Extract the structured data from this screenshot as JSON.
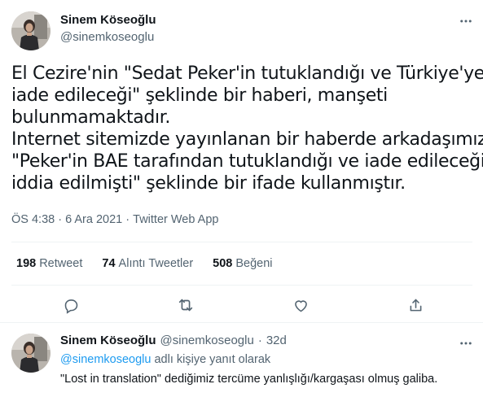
{
  "tweet": {
    "author_name": "Sinem Köseoğlu",
    "author_handle": "@sinemkoseoglu",
    "text_lines": [
      "El Cezire'nin \"Sedat Peker'in tutuklandığı ve Türkiye'ye",
      "iade edileceği\" şeklinde bir haberi, manşeti",
      "bulunmamaktadır.",
      "Internet sitemizde yayınlanan bir haberde arkadaşımız",
      "\"Peker'in BAE tarafından tutuklandığı ve iade edileceği",
      "iddia edilmişti\" şeklinde bir ifade kullanmıştır."
    ],
    "time": "ÖS 4:38",
    "separator": " · ",
    "date": "6 Ara 2021",
    "source": "Twitter Web App"
  },
  "stats": {
    "retweets_count": "198",
    "retweets_label": "Retweet",
    "quotes_count": "74",
    "quotes_label": "Alıntı Tweetler",
    "likes_count": "508",
    "likes_label": "Beğeni"
  },
  "reply": {
    "author_name": "Sinem Köseoğlu",
    "author_handle": "@sinemkoseoglu",
    "separator": "·",
    "age": "32d",
    "replying_to_handle": "@sinemkoseoglu",
    "replying_to_suffix": " adlı kişiye yanıt olarak",
    "text": "\"Lost in translation\" dediğimiz tercüme yanlışlığı/kargaşası olmuş galiba."
  },
  "colors": {
    "text": "#0f1419",
    "secondary": "#536471",
    "link": "#1d9bf0",
    "border": "#eff3f4"
  },
  "icons": {
    "more": "more-horizontal-icon",
    "reply": "reply-icon",
    "retweet": "retweet-icon",
    "like": "like-icon",
    "share": "share-icon"
  }
}
